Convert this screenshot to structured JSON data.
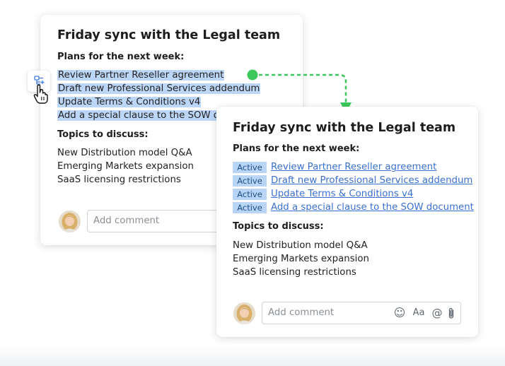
{
  "back_card": {
    "title": "Friday sync with the Legal team",
    "plans_heading": "Plans for the next week:",
    "plans": [
      "Review Partner Reseller agreement",
      "Draft new Professional Services addendum",
      "Update Terms & Conditions v4",
      "Add a special clause to the SOW docum"
    ],
    "topics_heading": "Topics to discuss:",
    "topics": [
      "New Distribution model Q&A",
      "Emerging Markets expansion",
      "SaaS licensing restrictions"
    ],
    "comment_placeholder": "Add comment"
  },
  "front_card": {
    "title": "Friday sync with the Legal team",
    "plans_heading": "Plans for the next week:",
    "tasks": [
      {
        "status": "Active",
        "label": "Review Partner Reseller agreement"
      },
      {
        "status": "Active",
        "label": "Draft new Professional Services addendum"
      },
      {
        "status": "Active",
        "label": "Update Terms & Conditions v4"
      },
      {
        "status": "Active",
        "label": "Add a special clause to the SOW document"
      }
    ],
    "topics_heading": "Topics to discuss:",
    "topics": [
      "New Distribution model Q&A",
      "Emerging Markets expansion",
      "SaaS licensing restrictions"
    ],
    "comment_placeholder": "Add comment",
    "comment_tools": [
      {
        "icon": "emoji-icon",
        "glyph": "☺"
      },
      {
        "icon": "text-format-icon",
        "glyph": "Aa"
      },
      {
        "icon": "mention-icon",
        "glyph": "@"
      },
      {
        "icon": "attachment-icon",
        "glyph": ""
      }
    ]
  },
  "colors": {
    "selection_highlight": "#bcd6f7",
    "badge_bg": "#b9d5f5",
    "link": "#3a6fd0",
    "connector": "#3cc85a"
  },
  "icons": {
    "create_task": "create-task-icon",
    "cursor": "hand-cursor-icon"
  }
}
